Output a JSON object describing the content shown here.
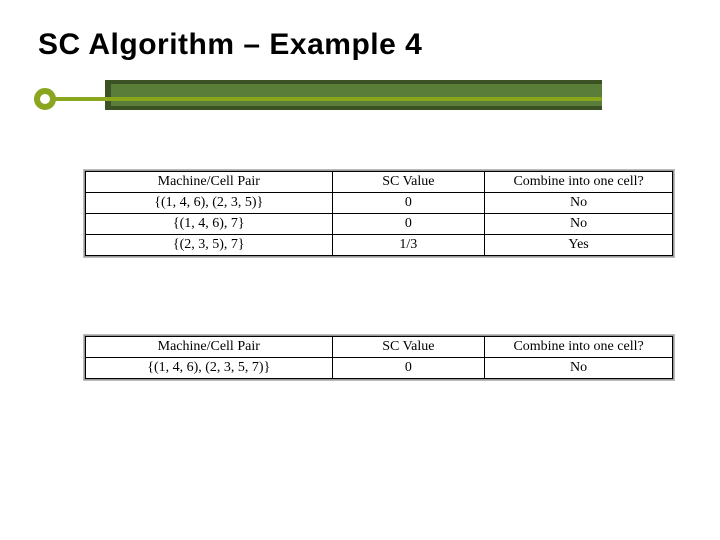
{
  "title": "SC Algorithm – Example 4",
  "tables": [
    {
      "headers": [
        "Machine/Cell Pair",
        "SC Value",
        "Combine into one cell?"
      ],
      "rows": [
        [
          "{(1, 4, 6),  (2, 3, 5)}",
          "0",
          "No"
        ],
        [
          "{(1, 4, 6), 7}",
          "0",
          "No"
        ],
        [
          "{(2, 3, 5), 7}",
          "1/3",
          "Yes"
        ]
      ]
    },
    {
      "headers": [
        "Machine/Cell Pair",
        "SC Value",
        "Combine into one cell?"
      ],
      "rows": [
        [
          "{(1, 4, 6),  (2, 3, 5, 7)}",
          "0",
          "No"
        ]
      ]
    }
  ]
}
